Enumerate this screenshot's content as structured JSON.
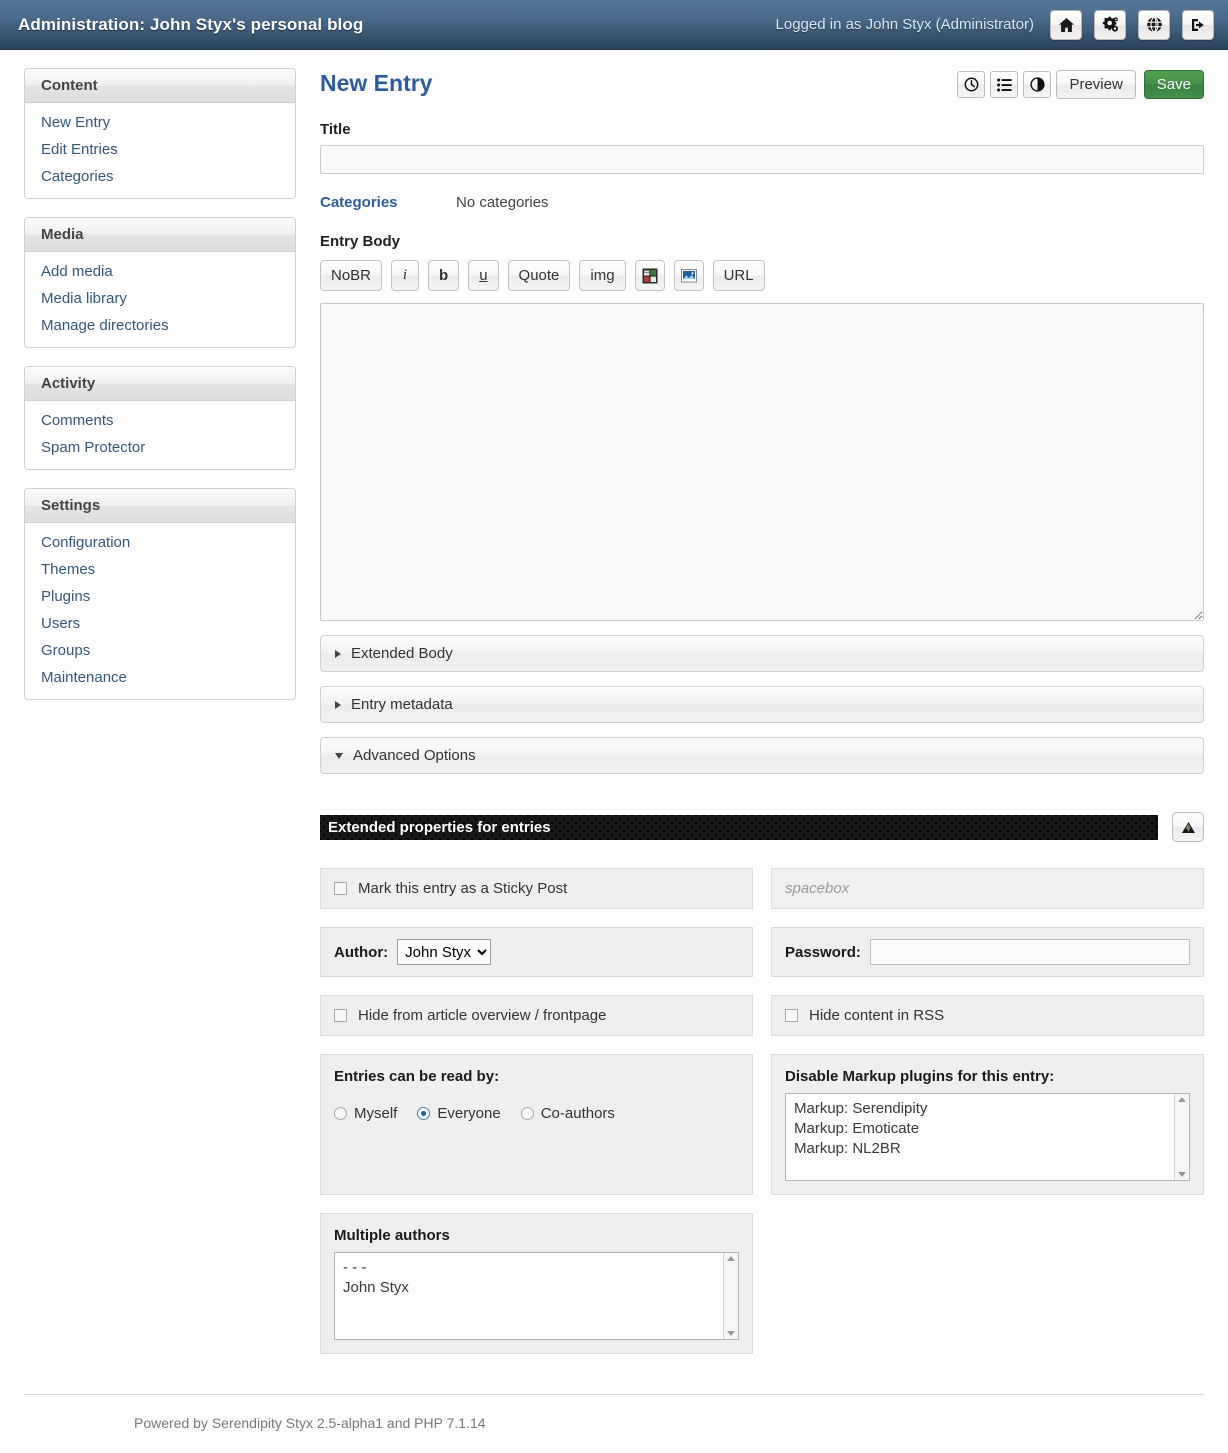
{
  "header": {
    "title": "Administration: John Styx's personal blog",
    "logged_in": "Logged in as John Styx (Administrator)",
    "icons": [
      {
        "name": "home-icon",
        "label": "Home"
      },
      {
        "name": "gears-icon",
        "label": "Configuration"
      },
      {
        "name": "globe-icon",
        "label": "Visit blog"
      },
      {
        "name": "logout-icon",
        "label": "Logout"
      }
    ]
  },
  "sidebar": {
    "blocks": [
      {
        "title": "Content",
        "items": [
          {
            "label": "New Entry"
          },
          {
            "label": "Edit Entries"
          },
          {
            "label": "Categories"
          }
        ]
      },
      {
        "title": "Media",
        "items": [
          {
            "label": "Add media"
          },
          {
            "label": "Media library"
          },
          {
            "label": "Manage directories"
          }
        ]
      },
      {
        "title": "Activity",
        "items": [
          {
            "label": "Comments"
          },
          {
            "label": "Spam Protector"
          }
        ]
      },
      {
        "title": "Settings",
        "items": [
          {
            "label": "Configuration"
          },
          {
            "label": "Themes"
          },
          {
            "label": "Plugins"
          },
          {
            "label": "Users"
          },
          {
            "label": "Groups"
          },
          {
            "label": "Maintenance"
          }
        ]
      }
    ]
  },
  "main": {
    "page_title": "New Entry",
    "toolbar": {
      "icons": [
        {
          "name": "clock-icon",
          "label": "Scheduling"
        },
        {
          "name": "list-icon",
          "label": "Entry list"
        },
        {
          "name": "contrast-icon",
          "label": "Toggle contrast"
        }
      ],
      "preview_label": "Preview",
      "save_label": "Save"
    },
    "title_field": {
      "label": "Title",
      "value": "",
      "placeholder": ""
    },
    "categories": {
      "link_label": "Categories",
      "value": "No categories"
    },
    "entry_body": {
      "label": "Entry Body",
      "value": "",
      "markup_buttons": [
        {
          "label": "NoBR",
          "name": "nobr-button",
          "style": "plain"
        },
        {
          "label": "i",
          "name": "italic-button",
          "style": "italic"
        },
        {
          "label": "b",
          "name": "bold-button",
          "style": "bold"
        },
        {
          "label": "u",
          "name": "underline-button",
          "style": "under"
        },
        {
          "label": "Quote",
          "name": "quote-button",
          "style": "plain"
        },
        {
          "label": "img",
          "name": "img-button",
          "style": "plain"
        },
        {
          "label": "",
          "name": "media-gallery-icon-button",
          "style": "icon-gallery"
        },
        {
          "label": "",
          "name": "insert-image-icon-button",
          "style": "icon-photo"
        },
        {
          "label": "URL",
          "name": "url-button",
          "style": "plain"
        }
      ]
    },
    "panels": [
      {
        "label": "Extended Body",
        "state": "collapsed"
      },
      {
        "label": "Entry metadata",
        "state": "collapsed"
      },
      {
        "label": "Advanced Options",
        "state": "expanded"
      }
    ],
    "extended_properties": {
      "title": "Extended properties for entries",
      "collapse_label": "▲",
      "sticky": {
        "label": "Mark this entry as a Sticky Post",
        "checked": false
      },
      "spacebox": {
        "placeholder": "spacebox",
        "value": ""
      },
      "author": {
        "label": "Author:",
        "value": "John Styx",
        "options": [
          "John Styx"
        ]
      },
      "password": {
        "label": "Password:",
        "value": ""
      },
      "hide_frontpage": {
        "label": "Hide from article overview / frontpage",
        "checked": false
      },
      "hide_rss": {
        "label": "Hide content in RSS",
        "checked": false
      },
      "read_by": {
        "title": "Entries can be read by:",
        "options": [
          {
            "label": "Myself",
            "selected": false
          },
          {
            "label": "Everyone",
            "selected": true
          },
          {
            "label": "Co-authors",
            "selected": false
          }
        ]
      },
      "disable_markup": {
        "title": "Disable Markup plugins for this entry:",
        "options": [
          "Markup: Serendipity",
          "Markup: Emoticate",
          "Markup: NL2BR"
        ]
      },
      "multiple_authors": {
        "title": "Multiple authors",
        "options": [
          "- - -",
          "John Styx"
        ]
      }
    }
  },
  "footer": {
    "text": "Powered by Serendipity Styx 2.5-alpha1 and PHP 7.1.14"
  },
  "colors": {
    "header_top": "#54789a",
    "header_bottom": "#2b4259",
    "accent_link": "#33577c",
    "page_title": "#2d5c9e",
    "save_green": "#45914a",
    "ext_bar": "#161616"
  }
}
